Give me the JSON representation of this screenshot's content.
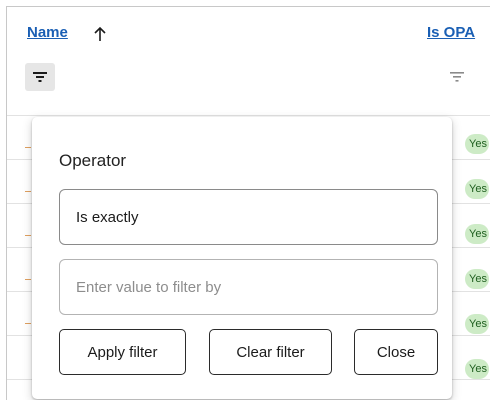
{
  "table": {
    "columns": [
      {
        "label": "Name",
        "sorted": "ascending",
        "sort_icon": "arrow-up-icon",
        "filter_icon": "filter-icon"
      },
      {
        "label": "Is OPA",
        "filter_icon": "filter-icon"
      }
    ],
    "rows": [
      {
        "badge": "Yes"
      },
      {
        "badge": "Yes"
      },
      {
        "badge": "Yes"
      },
      {
        "badge": "Yes"
      },
      {
        "badge": "Yes"
      },
      {
        "badge": "Yes"
      }
    ]
  },
  "filter_popover": {
    "operator_label": "Operator",
    "operator_value": "Is exactly",
    "value_placeholder": "Enter value to filter by",
    "apply_label": "Apply filter",
    "clear_label": "Clear filter",
    "close_label": "Close"
  },
  "colors": {
    "link": "#1a5fb4",
    "badge_bg": "#cdebc6",
    "active_filter_bg": "#e6e6e6"
  }
}
